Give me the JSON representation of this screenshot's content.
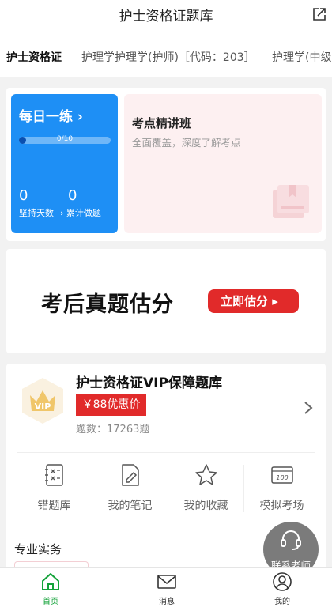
{
  "header": {
    "title": "护士资格证题库"
  },
  "tabs": [
    "护士资格证",
    "护理学护理学(护师)［代码：203］",
    "护理学(中级"
  ],
  "daily": {
    "title": "每日一练 ›",
    "progress_text": "0/10",
    "progress": 0,
    "days_value": "0",
    "days_label": "坚持天数",
    "total_value": "0",
    "total_label": "› 累计做题"
  },
  "kaodian": {
    "title": "考点精讲班",
    "subtitle": "全面覆盖，深度了解考点"
  },
  "banner": {
    "text": "考后真题估分",
    "button": "立即估分 ▸"
  },
  "vip": {
    "title": "护士资格证VIP保障题库",
    "price": "￥88优惠价",
    "count": "题数：17263题",
    "badge_text": "VIP"
  },
  "tools": [
    "错题库",
    "我的笔记",
    "我的收藏",
    "模拟考场"
  ],
  "section": {
    "title": "专业实务"
  },
  "contact": {
    "label": "联系老师"
  },
  "tabbar": [
    {
      "label": "首页",
      "icon": "home-icon"
    },
    {
      "label": "消息",
      "icon": "mail-icon"
    },
    {
      "label": "我的",
      "icon": "user-icon"
    }
  ],
  "colors": {
    "accent": "#1e8ff5",
    "red": "#e12a2a",
    "green": "#14a33a",
    "pink": "#fdf0f1"
  }
}
